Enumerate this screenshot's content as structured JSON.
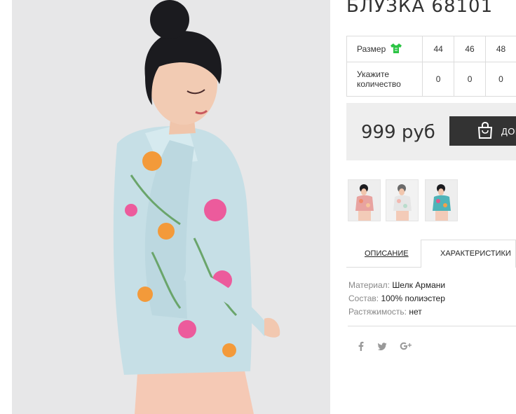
{
  "product": {
    "title": "БЛУЗКА 68101"
  },
  "size_table": {
    "size_label": "Размер",
    "size_icon": "t-shirt-icon",
    "size_icon_color": "#2bc444",
    "quantity_label_line1": "Укажите",
    "quantity_label_line2": "количество",
    "sizes": [
      "44",
      "46",
      "48"
    ],
    "quantities": [
      "0",
      "0",
      "0"
    ]
  },
  "price": {
    "value": "999 руб",
    "add_to_cart_label": "ДОБ",
    "cart_icon": "shopping-bag-icon"
  },
  "tabs": {
    "description": "ОПИСАНИЕ",
    "characteristics": "ХАРАКТЕРИСТИКИ"
  },
  "specs": [
    {
      "key": "Материал:",
      "value": "Шелк Армани"
    },
    {
      "key": "Состав:",
      "value": "100% полиэстер"
    },
    {
      "key": "Растяжимость:",
      "value": "нет"
    }
  ],
  "social": {
    "icons": [
      "facebook-icon",
      "twitter-icon",
      "google-plus-icon"
    ],
    "icon_color": "#999999"
  }
}
